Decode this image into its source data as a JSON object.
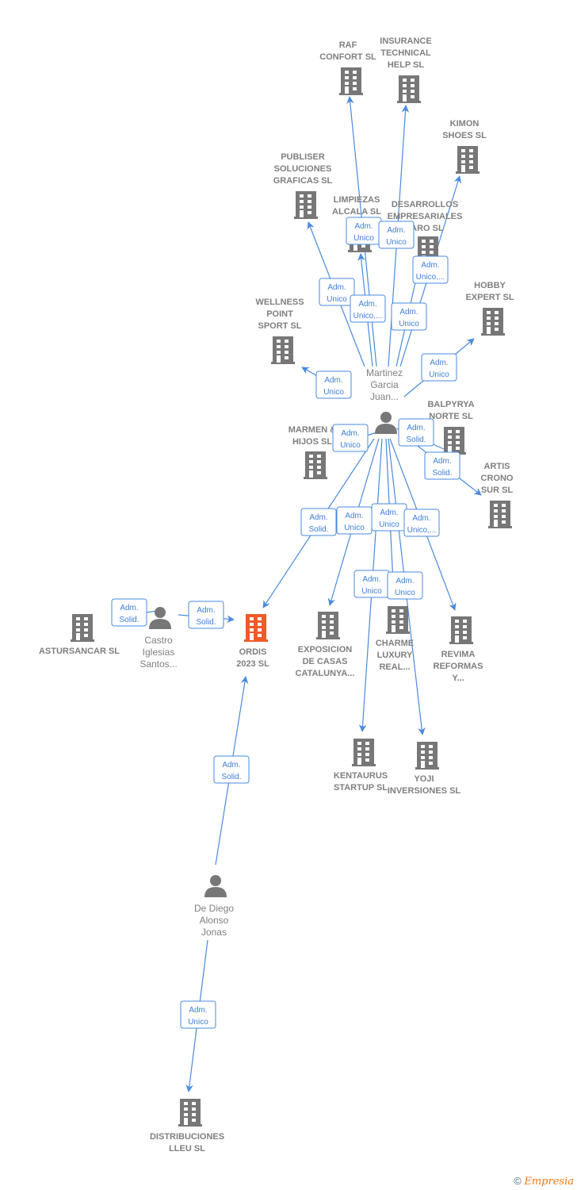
{
  "colors": {
    "edge": "#4a8ae0",
    "building": "#777777",
    "focus": "#f05a28",
    "text": "#7f7f7f",
    "label": "#3d7fd9"
  },
  "nodes": [
    {
      "id": "raf",
      "type": "company",
      "label": [
        "RAF",
        "CONFORT SL"
      ]
    },
    {
      "id": "insurance",
      "type": "company",
      "label": [
        "INSURANCE",
        "TECHNICAL",
        "HELP  SL"
      ]
    },
    {
      "id": "kimon",
      "type": "company",
      "label": [
        "KIMON",
        "SHOES  SL"
      ]
    },
    {
      "id": "publiser",
      "type": "company",
      "label": [
        "PUBLISER",
        "SOLUCIONES",
        "GRAFICAS SL"
      ]
    },
    {
      "id": "limpiezas",
      "type": "company",
      "label": [
        "LIMPIEZAS",
        "ALCALA SL"
      ]
    },
    {
      "id": "desarrollos",
      "type": "company",
      "label": [
        "DESARROLLOS",
        "EMPRESARIALES",
        "TARO SL"
      ]
    },
    {
      "id": "hobby",
      "type": "company",
      "label": [
        "HOBBY",
        "EXPERT  SL"
      ]
    },
    {
      "id": "wellness",
      "type": "company",
      "label": [
        "WELLNESS",
        "POINT",
        "SPORT  SL"
      ]
    },
    {
      "id": "martinez",
      "type": "person",
      "label": [
        "Martinez",
        "Garcia",
        "Juan..."
      ]
    },
    {
      "id": "balpyrya",
      "type": "company",
      "label": [
        "BALPYRYA",
        "NORTE SL"
      ]
    },
    {
      "id": "marmen",
      "type": "company",
      "label": [
        "MARMEN &",
        "HIJOS  SL"
      ]
    },
    {
      "id": "artis",
      "type": "company",
      "label": [
        "ARTIS",
        "CRONO",
        "SUR SL"
      ]
    },
    {
      "id": "astursancar",
      "type": "company",
      "label": [
        "ASTURSANCAR SL"
      ]
    },
    {
      "id": "castro",
      "type": "person",
      "label": [
        "Castro",
        "Iglesias",
        "Santos..."
      ]
    },
    {
      "id": "ordis",
      "type": "company",
      "focus": true,
      "label": [
        "ORDIS",
        "2023  SL"
      ]
    },
    {
      "id": "exposicion",
      "type": "company",
      "label": [
        "EXPOSICION",
        "DE CASAS",
        "CATALUNYA..."
      ]
    },
    {
      "id": "charme",
      "type": "company",
      "label": [
        "CHARME",
        "LUXURY",
        "REAL..."
      ]
    },
    {
      "id": "revima",
      "type": "company",
      "label": [
        "REVIMA",
        "REFORMAS",
        "Y..."
      ]
    },
    {
      "id": "kentaurus",
      "type": "company",
      "label": [
        "KENTAURUS",
        "STARTUP  SL"
      ]
    },
    {
      "id": "yoji",
      "type": "company",
      "label": [
        "YOJI",
        "INVERSIONES SL"
      ]
    },
    {
      "id": "dediego",
      "type": "person",
      "label": [
        "De Diego",
        "Alonso",
        "Jonas"
      ]
    },
    {
      "id": "distribuciones",
      "type": "company",
      "label": [
        "DISTRIBUCIONES",
        "LLEU  SL"
      ]
    }
  ],
  "edges": [
    {
      "from": "martinez",
      "to": "raf",
      "label": [
        "Adm.",
        "Unico"
      ]
    },
    {
      "from": "martinez",
      "to": "insurance",
      "label": [
        "Adm.",
        "Unico"
      ]
    },
    {
      "from": "martinez",
      "to": "kimon",
      "label": [
        "Adm.",
        "Unico,..."
      ]
    },
    {
      "from": "martinez",
      "to": "publiser",
      "label": [
        "Adm.",
        "Unico"
      ]
    },
    {
      "from": "martinez",
      "to": "limpiezas",
      "label": [
        "Adm.",
        "Unico,..."
      ]
    },
    {
      "from": "martinez",
      "to": "desarrollos",
      "label": [
        "Adm.",
        "Unico"
      ]
    },
    {
      "from": "martinez",
      "to": "wellness",
      "label": [
        "Adm.",
        "Unico"
      ]
    },
    {
      "from": "martinez",
      "to": "hobby",
      "label": [
        "Adm.",
        "Unico"
      ]
    },
    {
      "from": "martinez",
      "to": "balpyrya",
      "label": [
        "Adm.",
        "Solid."
      ]
    },
    {
      "from": "martinez",
      "to": "artis",
      "label": [
        "Adm.",
        "Solid."
      ]
    },
    {
      "from": "martinez",
      "to": "marmen",
      "label": [
        "Adm.",
        "Unico"
      ]
    },
    {
      "from": "martinez",
      "to": "ordis",
      "label": [
        "Adm.",
        "Solid."
      ]
    },
    {
      "from": "martinez",
      "to": "exposicion",
      "label": [
        "Adm.",
        "Unico"
      ]
    },
    {
      "from": "martinez",
      "to": "charme",
      "label": [
        "Adm.",
        "Unico"
      ]
    },
    {
      "from": "martinez",
      "to": "revima",
      "label": [
        "Adm.",
        "Unico,..."
      ]
    },
    {
      "from": "martinez",
      "to": "kentaurus",
      "label": [
        "Adm.",
        "Unico"
      ]
    },
    {
      "from": "martinez",
      "to": "yoji",
      "label": [
        "Adm.",
        "Unico"
      ]
    },
    {
      "from": "castro",
      "to": "ordis",
      "label": [
        "Adm.",
        "Solid."
      ]
    },
    {
      "from": "castro",
      "to": "astursancar",
      "label": [
        "Adm.",
        "Solid."
      ]
    },
    {
      "from": "dediego",
      "to": "ordis",
      "label": [
        "Adm.",
        "Solid."
      ]
    },
    {
      "from": "dediego",
      "to": "distribuciones",
      "label": [
        "Adm.",
        "Unico"
      ]
    }
  ],
  "footer": {
    "copyright": "©",
    "brand": "Empresia"
  }
}
